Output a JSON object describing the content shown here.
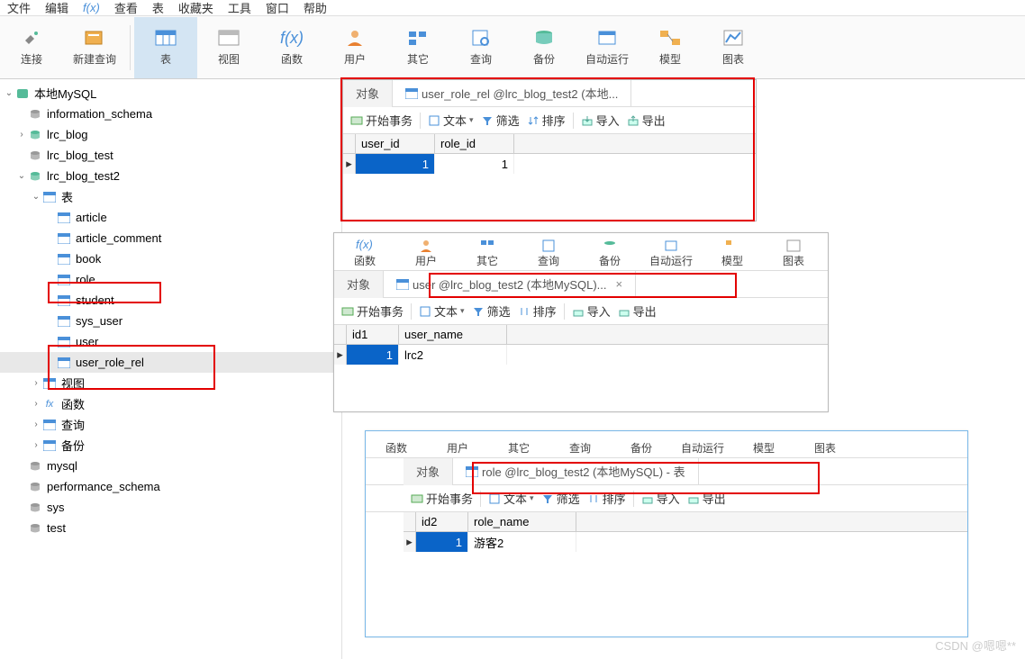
{
  "menubar": [
    "文件",
    "编辑",
    "",
    "查看",
    "表",
    "收藏夹",
    "",
    "工具",
    "窗口",
    "",
    "帮助"
  ],
  "menubar_fx": "f(x)",
  "toolbar": [
    {
      "label": "连接",
      "icon": "plug-icon"
    },
    {
      "label": "新建查询",
      "icon": "new-query-icon"
    },
    {
      "label": "表",
      "icon": "table-icon",
      "active": true
    },
    {
      "label": "视图",
      "icon": "view-icon"
    },
    {
      "label": "函数",
      "icon": "fx-icon"
    },
    {
      "label": "用户",
      "icon": "user-icon"
    },
    {
      "label": "其它",
      "icon": "other-icon"
    },
    {
      "label": "查询",
      "icon": "query-icon"
    },
    {
      "label": "备份",
      "icon": "backup-icon"
    },
    {
      "label": "自动运行",
      "icon": "auto-icon"
    },
    {
      "label": "模型",
      "icon": "model-icon"
    },
    {
      "label": "图表",
      "icon": "chart-icon"
    }
  ],
  "tree": {
    "root": "本地MySQL",
    "items": [
      {
        "name": "information_schema",
        "icon": "db-icon",
        "indent": 1
      },
      {
        "name": "lrc_blog",
        "icon": "db-icon",
        "indent": 1,
        "chev": "›",
        "green": true
      },
      {
        "name": "lrc_blog_test",
        "icon": "db-icon",
        "indent": 1
      },
      {
        "name": "lrc_blog_test2",
        "icon": "db-icon",
        "indent": 1,
        "chev": "⌄",
        "green": true
      },
      {
        "name": "表",
        "icon": "table-folder",
        "indent": 2,
        "chev": "⌄"
      },
      {
        "name": "article",
        "icon": "table-icon",
        "indent": 3
      },
      {
        "name": "article_comment",
        "icon": "table-icon",
        "indent": 3
      },
      {
        "name": "book",
        "icon": "table-icon",
        "indent": 3
      },
      {
        "name": "role",
        "icon": "table-icon",
        "indent": 3
      },
      {
        "name": "student",
        "icon": "table-icon",
        "indent": 3
      },
      {
        "name": "sys_user",
        "icon": "table-icon",
        "indent": 3
      },
      {
        "name": "user",
        "icon": "table-icon",
        "indent": 3
      },
      {
        "name": "user_role_rel",
        "icon": "table-icon",
        "indent": 3,
        "selected": true
      },
      {
        "name": "视图",
        "icon": "view-icon",
        "indent": 2,
        "chev": "›"
      },
      {
        "name": "函数",
        "icon": "fx-icon",
        "indent": 2,
        "chev": "›",
        "fx": true
      },
      {
        "name": "查询",
        "icon": "query-icon",
        "indent": 2,
        "chev": "›"
      },
      {
        "name": "备份",
        "icon": "backup-icon",
        "indent": 2,
        "chev": "›"
      },
      {
        "name": "mysql",
        "icon": "db-icon",
        "indent": 1
      },
      {
        "name": "performance_schema",
        "icon": "db-icon",
        "indent": 1
      },
      {
        "name": "sys",
        "icon": "db-icon",
        "indent": 1
      },
      {
        "name": "test",
        "icon": "db-icon",
        "indent": 1
      }
    ]
  },
  "panel1": {
    "tabs": [
      {
        "label": "对象"
      },
      {
        "label": "user_role_rel @lrc_blog_test2 (本地...",
        "icon": true
      }
    ],
    "tools": [
      "开始事务",
      "文本",
      "筛选",
      "排序",
      "导入",
      "导出"
    ],
    "headers": [
      "user_id",
      "role_id"
    ],
    "row": [
      "1",
      "1"
    ]
  },
  "mini_toolbar": [
    "函数",
    "用户",
    "其它",
    "查询",
    "备份",
    "自动运行",
    "模型",
    "图表"
  ],
  "panel2": {
    "tabs": [
      {
        "label": "对象"
      },
      {
        "label": "user @lrc_blog_test2 (本地MySQL)...",
        "icon": true,
        "close": true
      }
    ],
    "tools": [
      "开始事务",
      "文本",
      "筛选",
      "排序",
      "导入",
      "导出"
    ],
    "headers": [
      "id1",
      "user_name"
    ],
    "row": [
      "1",
      "lrc2"
    ]
  },
  "panel3": {
    "tabs": [
      {
        "label": "对象"
      },
      {
        "label": "role @lrc_blog_test2 (本地MySQL) - 表",
        "icon": true
      }
    ],
    "tools": [
      "开始事务",
      "文本",
      "筛选",
      "排序",
      "导入",
      "导出"
    ],
    "headers": [
      "id2",
      "role_name"
    ],
    "row": [
      "1",
      "游客2"
    ]
  },
  "watermark": "CSDN @嗯嗯**"
}
